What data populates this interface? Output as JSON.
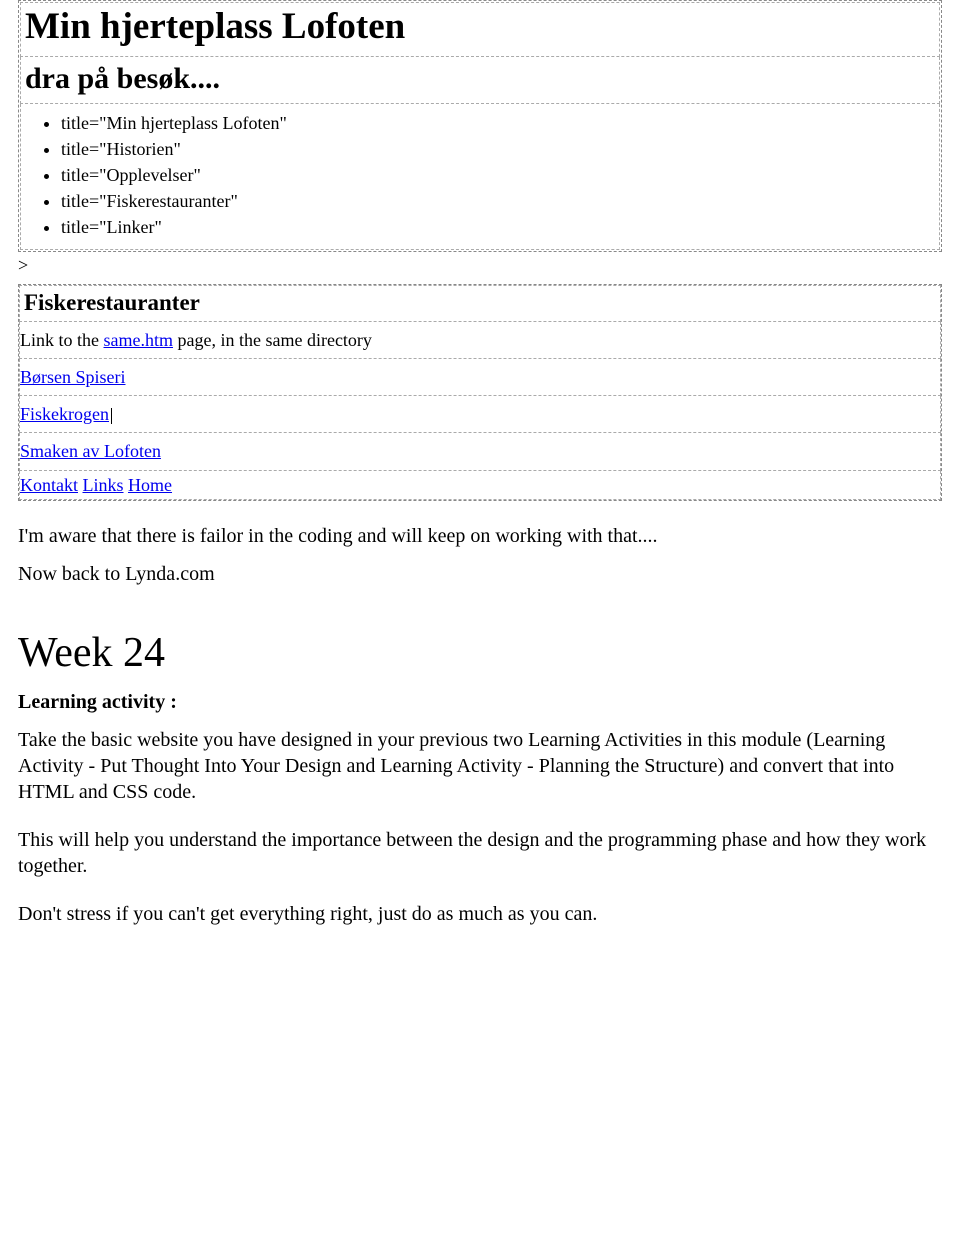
{
  "box1": {
    "h1": "Min hjerteplass Lofoten",
    "h2": "dra på besøk....",
    "titles": [
      "title=\"Min hjerteplass Lofoten\"",
      "title=\"Historien\"",
      "title=\"Opplevelser\"",
      "title=\"Fiskerestauranter\"",
      "title=\"Linker\""
    ]
  },
  "gt": ">",
  "box2": {
    "h3": "Fiskerestauranter",
    "linkline_prefix": "Link to the ",
    "linkline_link": "same.htm",
    "linkline_suffix": " page, in the same directory",
    "r1": "Børsen Spiseri",
    "r2": "Fiskekrogen",
    "r3": "Smaken av Lofoten",
    "footer_link1": "Kontakt",
    "footer_link2": "Links",
    "footer_link3": "Home"
  },
  "body": {
    "p1": "I'm aware that there is failor in the coding and will keep on working with that....",
    "p2": "Now back to Lynda.com",
    "week_heading": "Week 24",
    "la_label": "Learning activity :",
    "la_p1": "Take the basic website you have designed in your previous two Learning Activities in this module (Learning Activity - Put Thought Into Your Design and Learning Activity - Planning the Structure) and convert that into HTML and CSS code.",
    "la_p2": "This will help you understand the importance between the design and the programming phase and how they work together.",
    "la_p3": "Don't stress if you can't get everything right, just do as much as you can."
  }
}
